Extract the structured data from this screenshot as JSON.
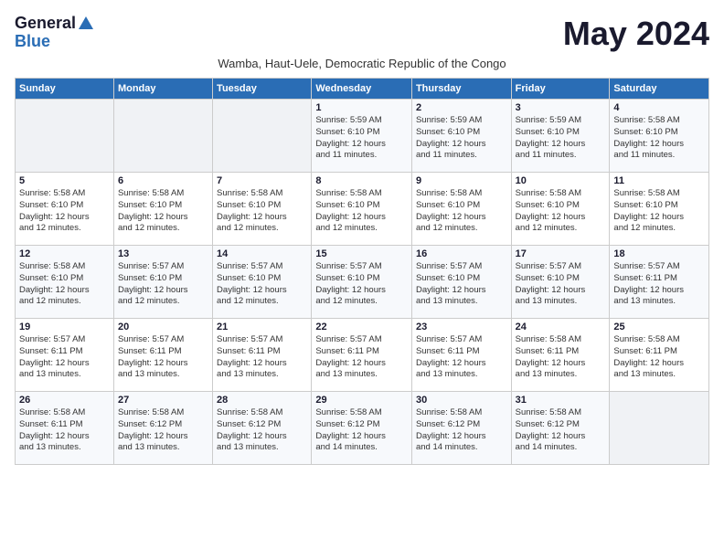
{
  "header": {
    "logo_general": "General",
    "logo_blue": "Blue",
    "month_title": "May 2024",
    "subtitle": "Wamba, Haut-Uele, Democratic Republic of the Congo"
  },
  "days_of_week": [
    "Sunday",
    "Monday",
    "Tuesday",
    "Wednesday",
    "Thursday",
    "Friday",
    "Saturday"
  ],
  "weeks": [
    {
      "days": [
        {
          "number": "",
          "info": ""
        },
        {
          "number": "",
          "info": ""
        },
        {
          "number": "",
          "info": ""
        },
        {
          "number": "1",
          "info": "Sunrise: 5:59 AM\nSunset: 6:10 PM\nDaylight: 12 hours\nand 11 minutes."
        },
        {
          "number": "2",
          "info": "Sunrise: 5:59 AM\nSunset: 6:10 PM\nDaylight: 12 hours\nand 11 minutes."
        },
        {
          "number": "3",
          "info": "Sunrise: 5:59 AM\nSunset: 6:10 PM\nDaylight: 12 hours\nand 11 minutes."
        },
        {
          "number": "4",
          "info": "Sunrise: 5:58 AM\nSunset: 6:10 PM\nDaylight: 12 hours\nand 11 minutes."
        }
      ]
    },
    {
      "days": [
        {
          "number": "5",
          "info": "Sunrise: 5:58 AM\nSunset: 6:10 PM\nDaylight: 12 hours\nand 12 minutes."
        },
        {
          "number": "6",
          "info": "Sunrise: 5:58 AM\nSunset: 6:10 PM\nDaylight: 12 hours\nand 12 minutes."
        },
        {
          "number": "7",
          "info": "Sunrise: 5:58 AM\nSunset: 6:10 PM\nDaylight: 12 hours\nand 12 minutes."
        },
        {
          "number": "8",
          "info": "Sunrise: 5:58 AM\nSunset: 6:10 PM\nDaylight: 12 hours\nand 12 minutes."
        },
        {
          "number": "9",
          "info": "Sunrise: 5:58 AM\nSunset: 6:10 PM\nDaylight: 12 hours\nand 12 minutes."
        },
        {
          "number": "10",
          "info": "Sunrise: 5:58 AM\nSunset: 6:10 PM\nDaylight: 12 hours\nand 12 minutes."
        },
        {
          "number": "11",
          "info": "Sunrise: 5:58 AM\nSunset: 6:10 PM\nDaylight: 12 hours\nand 12 minutes."
        }
      ]
    },
    {
      "days": [
        {
          "number": "12",
          "info": "Sunrise: 5:58 AM\nSunset: 6:10 PM\nDaylight: 12 hours\nand 12 minutes."
        },
        {
          "number": "13",
          "info": "Sunrise: 5:57 AM\nSunset: 6:10 PM\nDaylight: 12 hours\nand 12 minutes."
        },
        {
          "number": "14",
          "info": "Sunrise: 5:57 AM\nSunset: 6:10 PM\nDaylight: 12 hours\nand 12 minutes."
        },
        {
          "number": "15",
          "info": "Sunrise: 5:57 AM\nSunset: 6:10 PM\nDaylight: 12 hours\nand 12 minutes."
        },
        {
          "number": "16",
          "info": "Sunrise: 5:57 AM\nSunset: 6:10 PM\nDaylight: 12 hours\nand 13 minutes."
        },
        {
          "number": "17",
          "info": "Sunrise: 5:57 AM\nSunset: 6:10 PM\nDaylight: 12 hours\nand 13 minutes."
        },
        {
          "number": "18",
          "info": "Sunrise: 5:57 AM\nSunset: 6:11 PM\nDaylight: 12 hours\nand 13 minutes."
        }
      ]
    },
    {
      "days": [
        {
          "number": "19",
          "info": "Sunrise: 5:57 AM\nSunset: 6:11 PM\nDaylight: 12 hours\nand 13 minutes."
        },
        {
          "number": "20",
          "info": "Sunrise: 5:57 AM\nSunset: 6:11 PM\nDaylight: 12 hours\nand 13 minutes."
        },
        {
          "number": "21",
          "info": "Sunrise: 5:57 AM\nSunset: 6:11 PM\nDaylight: 12 hours\nand 13 minutes."
        },
        {
          "number": "22",
          "info": "Sunrise: 5:57 AM\nSunset: 6:11 PM\nDaylight: 12 hours\nand 13 minutes."
        },
        {
          "number": "23",
          "info": "Sunrise: 5:57 AM\nSunset: 6:11 PM\nDaylight: 12 hours\nand 13 minutes."
        },
        {
          "number": "24",
          "info": "Sunrise: 5:58 AM\nSunset: 6:11 PM\nDaylight: 12 hours\nand 13 minutes."
        },
        {
          "number": "25",
          "info": "Sunrise: 5:58 AM\nSunset: 6:11 PM\nDaylight: 12 hours\nand 13 minutes."
        }
      ]
    },
    {
      "days": [
        {
          "number": "26",
          "info": "Sunrise: 5:58 AM\nSunset: 6:11 PM\nDaylight: 12 hours\nand 13 minutes."
        },
        {
          "number": "27",
          "info": "Sunrise: 5:58 AM\nSunset: 6:12 PM\nDaylight: 12 hours\nand 13 minutes."
        },
        {
          "number": "28",
          "info": "Sunrise: 5:58 AM\nSunset: 6:12 PM\nDaylight: 12 hours\nand 13 minutes."
        },
        {
          "number": "29",
          "info": "Sunrise: 5:58 AM\nSunset: 6:12 PM\nDaylight: 12 hours\nand 14 minutes."
        },
        {
          "number": "30",
          "info": "Sunrise: 5:58 AM\nSunset: 6:12 PM\nDaylight: 12 hours\nand 14 minutes."
        },
        {
          "number": "31",
          "info": "Sunrise: 5:58 AM\nSunset: 6:12 PM\nDaylight: 12 hours\nand 14 minutes."
        },
        {
          "number": "",
          "info": ""
        }
      ]
    }
  ]
}
